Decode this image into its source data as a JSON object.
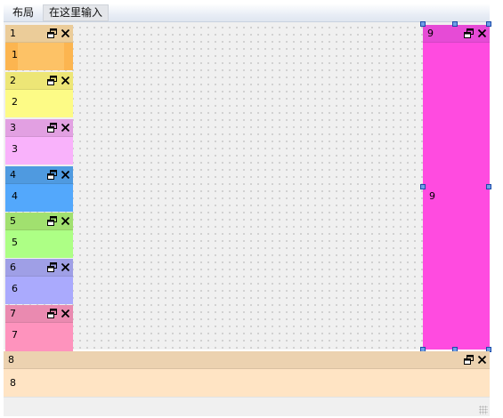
{
  "menu": {
    "items": [
      {
        "label": "布局"
      },
      {
        "label": "在这里输入"
      }
    ]
  },
  "left_docks": [
    {
      "title": "1",
      "content": "1",
      "head_color": "#ebcc99",
      "body_color": "#fcb550"
    },
    {
      "title": "2",
      "content": "2",
      "head_color": "#ede676",
      "body_color": "#fdfb86"
    },
    {
      "title": "3",
      "content": "3",
      "head_color": "#e2a0e2",
      "body_color": "#f9b2fb"
    },
    {
      "title": "4",
      "content": "4",
      "head_color": "#4f9ae0",
      "body_color": "#53a8fc"
    },
    {
      "title": "5",
      "content": "5",
      "head_color": "#a1e06f",
      "body_color": "#adff85"
    },
    {
      "title": "6",
      "content": "6",
      "head_color": "#9f9fe6",
      "body_color": "#aaaafd"
    },
    {
      "title": "7",
      "content": "7",
      "head_color": "#ea8ab0",
      "body_color": "#fe93bd"
    }
  ],
  "right_dock": {
    "title": "9",
    "content": "9",
    "head_color": "#e64bd6",
    "body_color": "#ff4be0"
  },
  "bottom_dock": {
    "title": "8",
    "content": "8",
    "head_color": "#ecd2b0",
    "body_color": "#ffe4c4"
  },
  "icons": {
    "restore": "restore-icon",
    "close": "close-icon"
  }
}
